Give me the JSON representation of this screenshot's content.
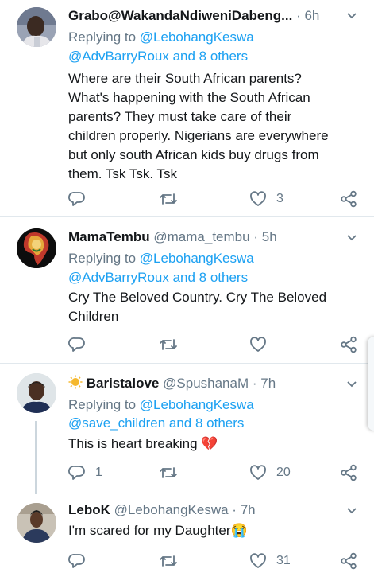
{
  "tweets": [
    {
      "name": "Grabo@WakandaNdiweniDabeng...",
      "handle": "",
      "time": "6h",
      "reply_prefix": "Replying to",
      "reply_to_1": "@LebohangKeswa",
      "reply_to_2": "@AdvBarryRoux and 8 others",
      "text_lines": [
        "Where are their South African parents?",
        "What's happening with the South African",
        "parents? They must take care of their",
        "children properly. Nigerians are everywhere",
        "but only south African kids buy drugs from",
        "them. Tsk Tsk. Tsk"
      ],
      "reply_count": "",
      "retweet_count": "",
      "like_count": "3"
    },
    {
      "name": "MamaTembu",
      "handle": "@mama_tembu",
      "time": "5h",
      "reply_prefix": "Replying to",
      "reply_to_1": "@LebohangKeswa",
      "reply_to_2": "@AdvBarryRoux and 8 others",
      "text_lines": [
        "Cry The Beloved Country. Cry The Beloved",
        "Children"
      ],
      "reply_count": "",
      "retweet_count": "",
      "like_count": ""
    },
    {
      "name": "Baristalove",
      "handle": "@SpushanaM",
      "time": "7h",
      "reply_prefix": "Replying to",
      "reply_to_1": "@LebohangKeswa",
      "reply_to_2": "@save_children and 8 others",
      "text_lines": [
        "This is heart breaking 💔"
      ],
      "reply_count": "1",
      "retweet_count": "",
      "like_count": "20"
    },
    {
      "name": "LeboK",
      "handle": "@LebohangKeswa",
      "time": "7h",
      "text_lines": [
        "I'm scared for my Daughter😭"
      ],
      "reply_count": "",
      "retweet_count": "",
      "like_count": "31"
    }
  ],
  "separator": "·",
  "icons": [
    "reply-icon",
    "retweet-icon",
    "like-icon",
    "share-icon",
    "chevron-down-icon"
  ],
  "colors": {
    "link": "#1da1f2",
    "secondary": "#657786",
    "divider": "#e1e8ed",
    "thread": "#ccd6dd"
  }
}
